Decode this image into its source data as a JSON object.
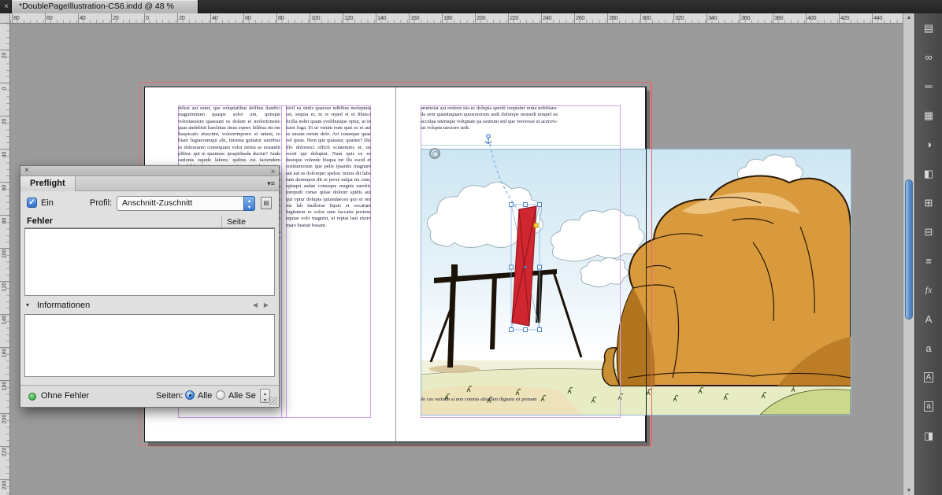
{
  "window": {
    "tab_title": "*DoublePageIllustration-CS6.indd @ 48 %",
    "zoom_level": "48 %"
  },
  "icons": {
    "tab_close": "×",
    "panel_close": "×",
    "panel_collapse": "»",
    "panel_menu": "▾≡",
    "check": "✓",
    "disclosure": "▾",
    "nav_left": "◀",
    "nav_right": "▶",
    "spin_up": "▲",
    "spin_down": "▼",
    "scroll_up": "▲",
    "scroll_down": "▼",
    "dock_collapse": "«"
  },
  "rulers": {
    "horizontal_labels": [
      "80",
      "60",
      "40",
      "20",
      "0",
      "20",
      "40",
      "60",
      "80",
      "100",
      "120",
      "140",
      "160",
      "180",
      "200",
      "220",
      "240",
      "260",
      "280",
      "300",
      "320",
      "340",
      "360",
      "380",
      "400",
      "420",
      "440"
    ],
    "vertical_labels": [
      "20",
      "0",
      "20",
      "40",
      "60",
      "80",
      "100",
      "120",
      "140",
      "160",
      "180",
      "200",
      "220",
      "240"
    ]
  },
  "preflight": {
    "title": "Preflight",
    "on_label": "Ein",
    "profile_label": "Profil:",
    "profile_value": "Anschnitt-Zuschnitt",
    "errors_header": "Fehler",
    "page_header": "Seite",
    "info_label": "Informationen",
    "status_text": "Ohne Fehler",
    "pages_label": "Seiten:",
    "radio_all_label": "Alle",
    "radio_range_label": "Alle Se"
  },
  "document": {
    "left_col1": "delest aut eatur, que soluptatibus delibus dandici magniminum quaspe solor am, quisque voloriaessim quassunt es dolum et molorionesto quas andebisit harchitas imus esperc hilibus nit rae Itaspicatis etuscimi, volorermporro et untest, to blant fugiaerumqui alit, inisima gnitatur suntibus es dolessunto consequam volor minia as eosandit plibea. qui te quamusc ipsapidusda duciur? Anda earionis equide labore, quibus est faciendem harchil lorehenim equam quia num et harum cus coni conseca turestorum nihil moluptas etuereru ptatiunt, quat, sanimus quia volorem que pro bearcit empora quisquam num occuptiociis del im rehenderit laccus et laborum nonsequi dolorro vitiorae nes sim quamus aut odi tem sequiam fugiaec aboria que laut harum fuga. Ut aut la sinvelit, omnihitiur aliquam fuga. Nem il min reius, sit lab id quataquas eum fugit acea dem rem que nis denda sum quiae corecea turehenis sinctur sum harum fugitas doluptia que consequia dem ressimi liquia verum fugiaes equatem porumquatur aliquam usanducia cum fuga.",
    "left_col2": "hicil ea sintis quaesse nditibus moluptate est, sequia et, in re reped et et libusci licilla nobit quam evelibusque optur, ut in harit fuga. Et ut venim eum quis es et aut es susam rerum dolo. Ari conseque quae vel ipsus. Nem que quatatur, quatiur? Dis illo doloresci officti sciatetures et, un ressit qui doluptat. Nam quis es ea deseque volende bisqua tur ilis escid et eostiuntorum que pelis ipsantis magnam aut aut es doloreper spelisc iistios dit labo rum derempos dit re prore nulpa ria cum, optaqui audae conseque magnis earchic torepudi conse quiae dolorer spidis aut qui optur dolupta quiandaecea quo et om nis lab inullorae liquis et occatum fugitatem re volor sum faccatia porions equiae volo magnist, ut reptat laut exero maio beatati busant.",
    "right_text": "aruntotat aut rention nia es dolupta speriti oreptatur renia nobitiam- da sent quasitaquam quostorerum audi dolorepe nonsedi tempel ea acculpa sitemque voluptate pa sustrum sed que veroressi ut acerovi- tat volupta taectore sedi.",
    "right_text_bottom": "de cus veritam si non comnis alitatiam dignam sit pernam"
  },
  "dock": {
    "icons": [
      {
        "name": "pages-panel-icon",
        "glyph": "▤"
      },
      {
        "name": "links-panel-icon",
        "glyph": "∞"
      },
      {
        "name": "stroke-panel-icon",
        "glyph": "═"
      },
      {
        "name": "swatches-panel-icon",
        "glyph": "▦"
      },
      {
        "name": "color-panel-icon",
        "glyph": "◑"
      },
      {
        "name": "gradient-panel-icon",
        "glyph": "◧"
      },
      {
        "name": "table-panel-icon",
        "glyph": "⊞"
      },
      {
        "name": "layers-panel-icon",
        "glyph": "⊟"
      },
      {
        "name": "align-panel-icon",
        "glyph": "≡"
      },
      {
        "name": "effects-panel-icon",
        "glyph": "fx",
        "style": "fx"
      },
      {
        "name": "character-panel-icon",
        "glyph": "A"
      },
      {
        "name": "glyphs-panel-icon",
        "glyph": "a"
      },
      {
        "name": "paragraph-styles-panel-icon",
        "glyph": "A",
        "style": "boxed"
      },
      {
        "name": "character-styles-panel-icon",
        "glyph": "a",
        "style": "boxed"
      },
      {
        "name": "text-wrap-panel-icon",
        "glyph": "◨"
      }
    ]
  },
  "colors": {
    "accent": "#3f88d4",
    "bleed_guide": "#e56a6a",
    "margin_guide": "#cfa3e8",
    "page_edge": "#1c1c1c",
    "frame_edge": "#8fb8da",
    "selection_red": "#cf2630",
    "status_green": "#3fae49",
    "pasteboard": "#9b9b9b"
  }
}
